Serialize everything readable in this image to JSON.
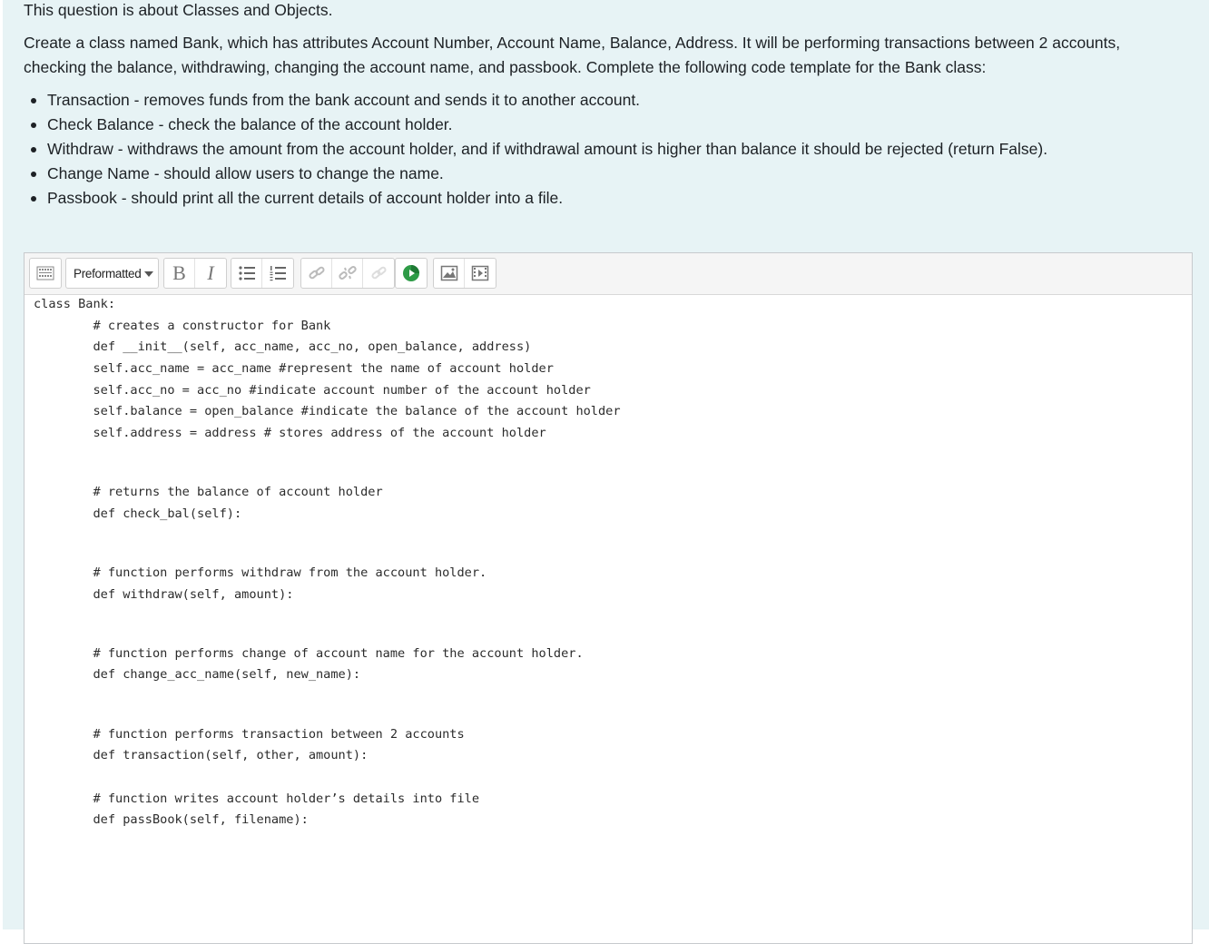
{
  "question": {
    "intro": "This question is about Classes and Objects.",
    "description_line1": "Create a class named Bank, which has attributes Account Number, Account Name, Balance, Address. It will be performing transactions between 2 accounts,",
    "description_line2": "checking the balance, withdrawing, changing the account name, and passbook. Complete the following code template for the Bank class:",
    "bullets": [
      "Transaction - removes funds from the bank account and sends it to another account.",
      "Check Balance - check the balance of the account holder.",
      "Withdraw - withdraws the amount from the account holder, and if withdrawal amount is higher than balance it should be rejected (return False).",
      "Change Name - should allow users to change the name.",
      "Passbook - should print all the current details of account holder into a file."
    ]
  },
  "toolbar": {
    "format_select": "Preformatted",
    "bold_label": "B",
    "italic_label": "I",
    "icons": [
      "toolbar-toggle-icon",
      "bullet-list-icon",
      "numbered-list-icon",
      "link-icon",
      "unlink-icon",
      "anchor-icon",
      "media-recorder-icon",
      "image-icon",
      "video-icon"
    ]
  },
  "code_lines": [
    "class Bank:",
    "        # creates a constructor for Bank",
    "        def __init__(self, acc_name, acc_no, open_balance, address)",
    "        self.acc_name = acc_name #represent the name of account holder",
    "        self.acc_no = acc_no #indicate account number of the account holder",
    "        self.balance = open_balance #indicate the balance of the account holder",
    "        self.address = address # stores address of the account holder",
    "        # returns the balance of account holder",
    "        def check_bal(self):",
    "        # function performs withdraw from the account holder.",
    "        def withdraw(self, amount):",
    "        # function performs change of account name for the account holder.",
    "        def change_acc_name(self, new_name):",
    "        # function performs transaction between 2 accounts",
    "        def transaction(self, other, amount):",
    "        # function writes account holder’s details into file",
    "        def passBook(self, filename):"
  ],
  "colors": {
    "panel_bg": "#e7f3f5",
    "text": "#1d2125",
    "recorder_green": "#2e9b47"
  }
}
